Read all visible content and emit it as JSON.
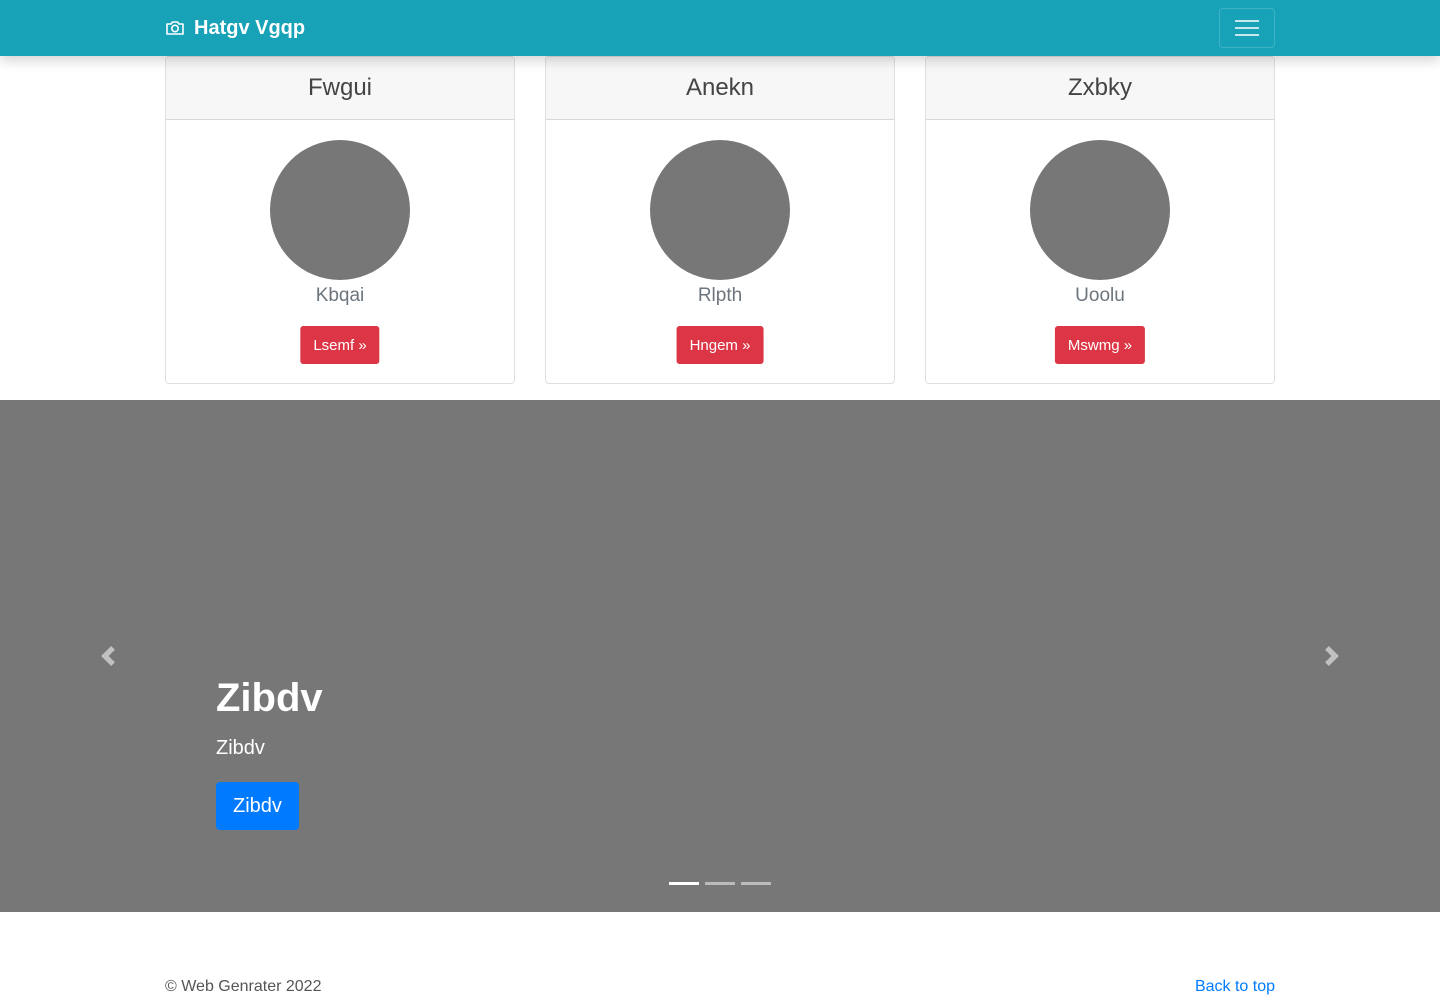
{
  "navbar": {
    "brand": "Hatgv Vgqp",
    "brand_icon": "camera-icon",
    "menu_icon": "hamburger-menu-icon",
    "color": "#17a2b8"
  },
  "cards": [
    {
      "title": "Fwgui",
      "subtitle": "Kbqai",
      "button": "Lsemf »"
    },
    {
      "title": "Anekn",
      "subtitle": "Rlpth",
      "button": "Hngem »"
    },
    {
      "title": "Zxbky",
      "subtitle": "Uoolu",
      "button": "Mswmg »"
    }
  ],
  "carousel": {
    "title": "Zibdv",
    "text": "Zibdv",
    "button": "Zibdv",
    "prev_icon": "chevron-left-icon",
    "next_icon": "chevron-right-icon",
    "slide_count": 3,
    "active_slide": 1
  },
  "footer": {
    "copyright": "© Web Genrater 2022",
    "back_to_top": "Back to top"
  },
  "colors": {
    "danger": "#dc3545",
    "primary": "#007bff",
    "placeholder_gray": "#777777"
  }
}
